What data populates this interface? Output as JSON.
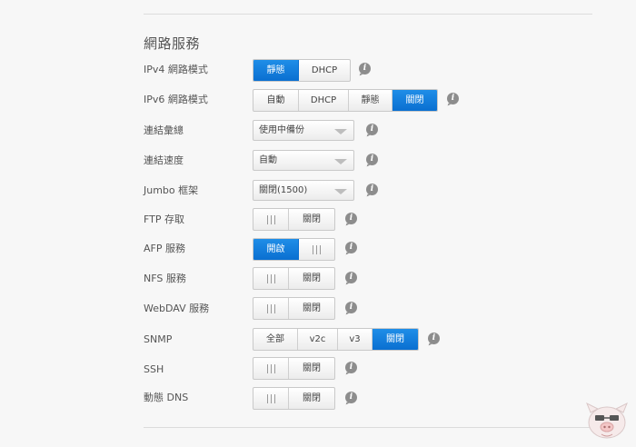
{
  "section_title": "網路服務",
  "rows": {
    "ipv4": {
      "label": "IPv4 網路模式",
      "options": [
        "靜態",
        "DHCP"
      ],
      "selected": "靜態"
    },
    "ipv6": {
      "label": "IPv6 網路模式",
      "options": [
        "自動",
        "DHCP",
        "靜態",
        "關閉"
      ],
      "selected": "關閉"
    },
    "link_agg": {
      "label": "連結彙總",
      "value": "使用中備份"
    },
    "link_speed": {
      "label": "連結速度",
      "value": "自動"
    },
    "jumbo": {
      "label": "Jumbo 框架",
      "value": "關閉(1500)"
    },
    "ftp": {
      "label": "FTP 存取",
      "state": "關閉"
    },
    "afp": {
      "label": "AFP 服務",
      "state": "開啟"
    },
    "nfs": {
      "label": "NFS 服務",
      "state": "關閉"
    },
    "webdav": {
      "label": "WebDAV 服務",
      "state": "關閉"
    },
    "snmp": {
      "label": "SNMP",
      "options": [
        "全部",
        "v2c",
        "v3",
        "關閉"
      ],
      "selected": "關閉"
    },
    "ssh": {
      "label": "SSH",
      "state": "關閉"
    },
    "ddns": {
      "label": "動態 DNS",
      "state": "關閉"
    }
  },
  "info_glyph": "i",
  "colors": {
    "accent": "#0a6fd1",
    "background": "#f7f7f7",
    "info_icon": "#8d8d8d"
  }
}
